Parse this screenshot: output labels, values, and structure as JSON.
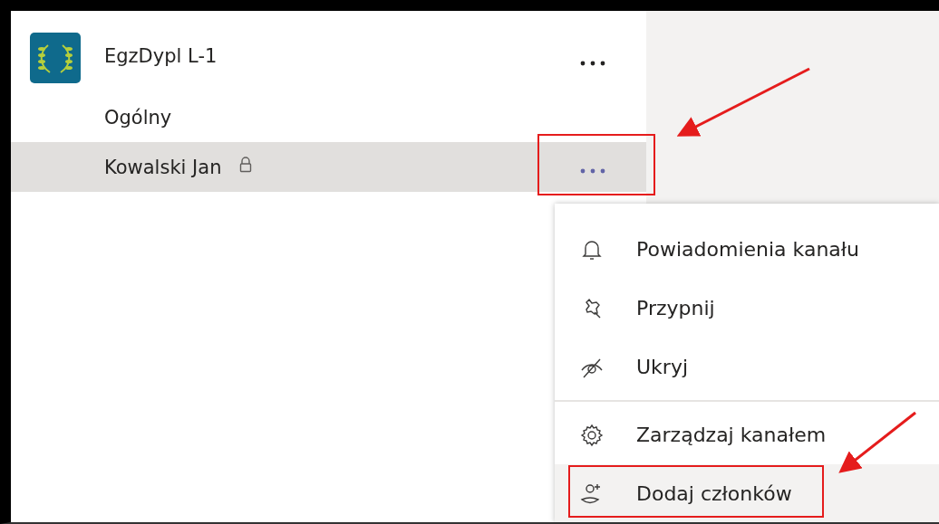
{
  "team": {
    "name": "EgzDypl L-1"
  },
  "channels": [
    {
      "name": "Ogólny",
      "selected": false,
      "private": false,
      "highlighted": false
    },
    {
      "name": "Kowalski Jan",
      "selected": true,
      "private": true,
      "highlighted": true
    }
  ],
  "menu": [
    {
      "label": "Powiadomienia kanału",
      "kind": "bell",
      "divider_before": false,
      "hover": false,
      "highlighted": false
    },
    {
      "label": "Przypnij",
      "kind": "pin",
      "divider_before": false,
      "hover": false,
      "highlighted": false
    },
    {
      "label": "Ukryj",
      "kind": "hide",
      "divider_before": false,
      "hover": false,
      "highlighted": false
    },
    {
      "label": "Zarządzaj kanałem",
      "kind": "gear",
      "divider_before": true,
      "hover": false,
      "highlighted": false
    },
    {
      "label": "Dodaj członków",
      "kind": "add-person",
      "divider_before": false,
      "hover": true,
      "highlighted": true
    }
  ]
}
